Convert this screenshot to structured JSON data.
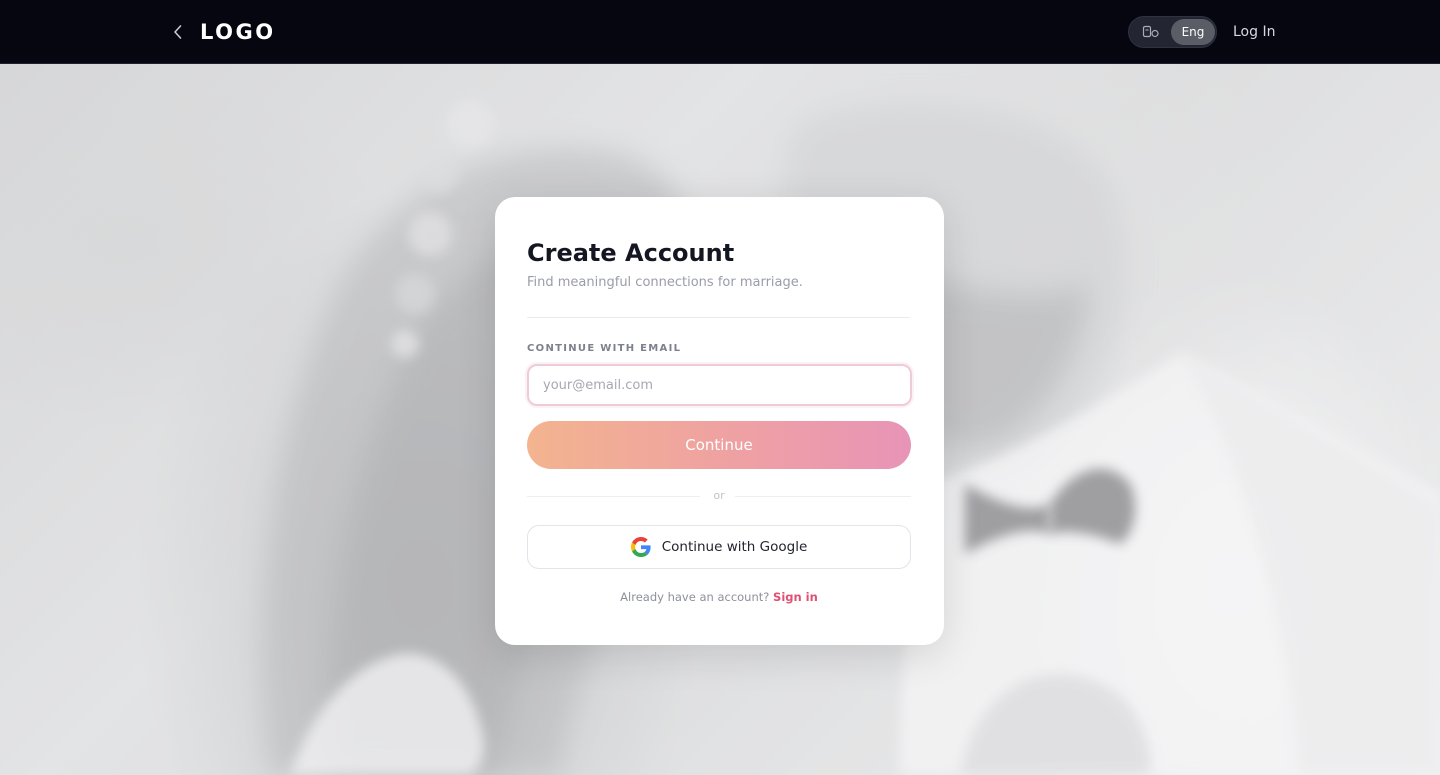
{
  "header": {
    "logo_text": "LOGO",
    "language_label": "Eng",
    "login_label": "Log In"
  },
  "icons": {
    "back": "chevron-left-icon",
    "language": "language-icon",
    "google": "google-icon"
  },
  "card": {
    "title": "Create Account",
    "subtitle": "Find meaningful connections for marriage.",
    "email_label": "CONTINUE WITH EMAIL",
    "email_placeholder": "your@email.com",
    "email_value": "",
    "continue_label": "Continue",
    "or_label": "or",
    "google_label": "Continue with Google",
    "signin_prompt": "Already have an account?",
    "signin_link": "Sign in"
  },
  "colors": {
    "header_bg": "#05060f",
    "accent": "#e04f74",
    "gradient_start": "#f3b48f",
    "gradient_end": "#e894b7",
    "input_border": "#f0cbd6"
  }
}
